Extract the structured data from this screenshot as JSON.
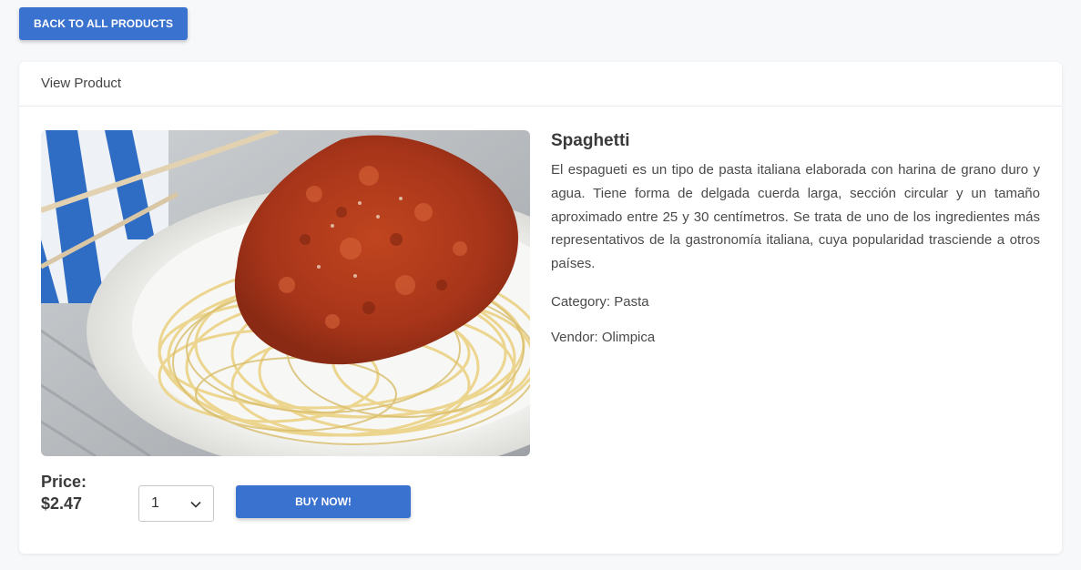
{
  "nav": {
    "back_label": "BACK TO ALL PRODUCTS"
  },
  "card": {
    "header_title": "View Product"
  },
  "product": {
    "name": "Spaghetti",
    "description": "El espagueti es un tipo de pasta italiana elaborada con harina de grano duro y agua. Tiene forma de delgada cuerda larga, sección circular y un tamaño aproximado entre 25 y 30 centímetros. Se trata de uno de los ingredientes más representativos de la gastronomía italiana, cuya popularidad trasciende a otros países.",
    "category_label": "Category:",
    "category": "Pasta",
    "vendor_label": "Vendor:",
    "vendor": "Olimpica",
    "image_alt": "spaghetti-photo"
  },
  "purchase": {
    "price_label": "Price:",
    "price": "$2.47",
    "quantity": "1",
    "buy_label": "BUY NOW!"
  },
  "colors": {
    "accent": "#3a72cf",
    "background": "#f7f8fa"
  },
  "icons": {
    "quantity_dropdown": "chevron-down-icon"
  }
}
